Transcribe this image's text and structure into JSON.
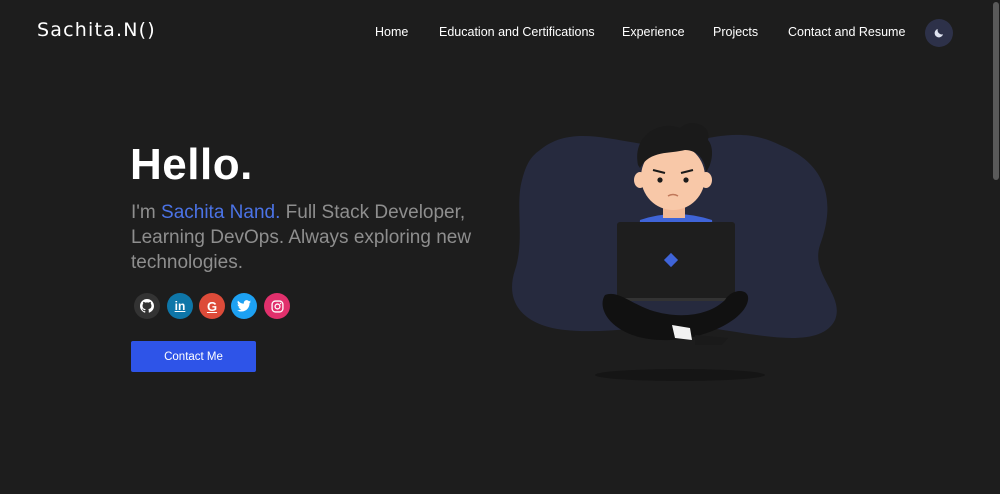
{
  "header": {
    "logo": "Sachita.N()",
    "nav": [
      "Home",
      "Education and Certifications",
      "Experience",
      "Projects",
      "Contact and Resume"
    ],
    "theme_toggle_icon": "moon-icon"
  },
  "hero": {
    "title": "Hello.",
    "intro_prefix": "I'm ",
    "name": "Sachita Nand.",
    "intro_rest": " Full Stack Developer, Learning DevOps. Always exploring new technologies.",
    "contact_button": "Contact Me"
  },
  "socials": [
    {
      "name": "github",
      "icon": "github-icon",
      "color": "#333333"
    },
    {
      "name": "linkedin",
      "icon": "linkedin-icon",
      "color": "#0e76a8"
    },
    {
      "name": "google",
      "icon": "google-icon",
      "color": "#dd4b39"
    },
    {
      "name": "twitter",
      "icon": "twitter-icon",
      "color": "#1da1f2"
    },
    {
      "name": "instagram",
      "icon": "instagram-icon",
      "color": "#e1306c"
    }
  ],
  "colors": {
    "background": "#1d1d1d",
    "accent": "#2e54e8",
    "name_highlight": "#4b73e6",
    "subtitle": "#8e8e8e",
    "blob": "#262a3e"
  }
}
